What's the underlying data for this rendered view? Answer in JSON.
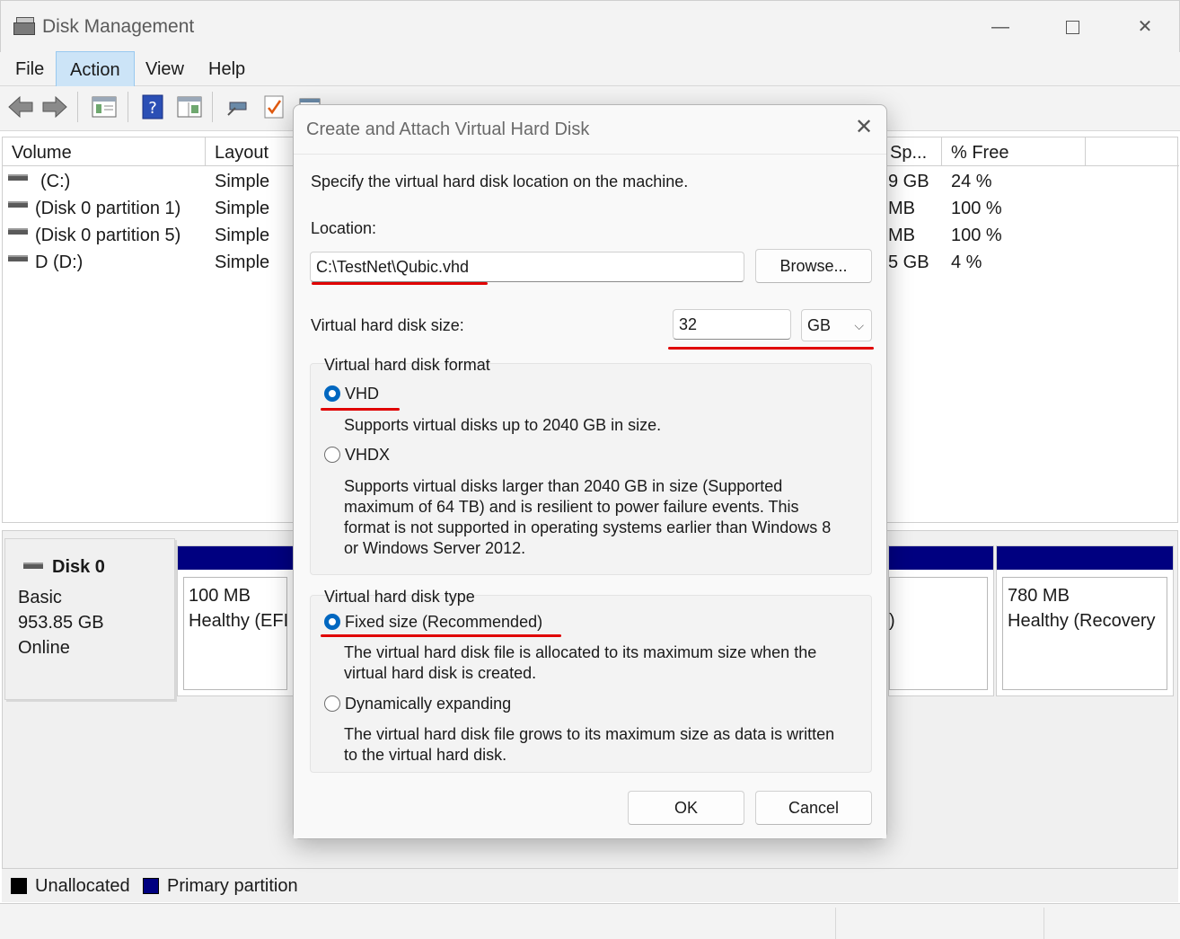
{
  "window": {
    "title": "Disk Management",
    "controls": {
      "minimize": "—",
      "maximize": "",
      "close": "✕"
    }
  },
  "menu": [
    "File",
    "Action",
    "View",
    "Help"
  ],
  "volume_list": {
    "columns": [
      "Volume",
      "Layout",
      "Sp...",
      "% Free"
    ],
    "rows": [
      {
        "volume": "(C:)",
        "layout": "Simple",
        "space": "9 GB",
        "free": "24 %"
      },
      {
        "volume": "(Disk 0 partition 1)",
        "layout": "Simple",
        "space": "MB",
        "free": "100 %"
      },
      {
        "volume": "(Disk 0 partition 5)",
        "layout": "Simple",
        "space": "MB",
        "free": "100 %"
      },
      {
        "volume": "D (D:)",
        "layout": "Simple",
        "space": "5 GB",
        "free": "4 %"
      }
    ]
  },
  "disk": {
    "name": "Disk 0",
    "type": "Basic",
    "size": "953.85 GB",
    "status": "Online",
    "partitions": [
      {
        "size": "100 MB",
        "status": "Healthy (EFI"
      },
      {
        "size": "",
        "status": ")"
      },
      {
        "size": "780 MB",
        "status": "Healthy (Recovery"
      }
    ]
  },
  "legend": {
    "unallocated": "Unallocated",
    "primary": "Primary partition",
    "unallocated_color": "#000000",
    "primary_color": "#000080"
  },
  "dialog": {
    "title": "Create and Attach Virtual Hard Disk",
    "close": "✕",
    "instruction": "Specify the virtual hard disk location on the machine.",
    "location_label": "Location:",
    "location_value": "C:\\TestNet\\Qubic.vhd",
    "browse_label": "Browse...",
    "size_label": "Virtual hard disk size:",
    "size_value": "32",
    "size_unit": "GB",
    "format_group": {
      "label": "Virtual hard disk format",
      "options": [
        {
          "label": "VHD",
          "selected": true,
          "description": "Supports virtual disks up to 2040 GB in size."
        },
        {
          "label": "VHDX",
          "selected": false,
          "description_lines": [
            "Supports virtual disks larger than 2040 GB in size (Supported",
            "maximum of 64 TB) and is resilient to power failure events. This",
            "format is not supported in operating systems earlier than Windows 8",
            "or Windows Server 2012."
          ]
        }
      ]
    },
    "type_group": {
      "label": "Virtual hard disk type",
      "options": [
        {
          "label": "Fixed size (Recommended)",
          "selected": true,
          "description_lines": [
            "The virtual hard disk file is allocated to its maximum size when the",
            "virtual hard disk is created."
          ]
        },
        {
          "label": "Dynamically expanding",
          "selected": false,
          "description_lines": [
            "The virtual hard disk file grows to its maximum size as data is written",
            "to the virtual hard disk."
          ]
        }
      ]
    },
    "ok_label": "OK",
    "cancel_label": "Cancel"
  },
  "colors": {
    "accent": "#0067c0",
    "highlight": "#e00000",
    "partition_bar": "#000080"
  }
}
